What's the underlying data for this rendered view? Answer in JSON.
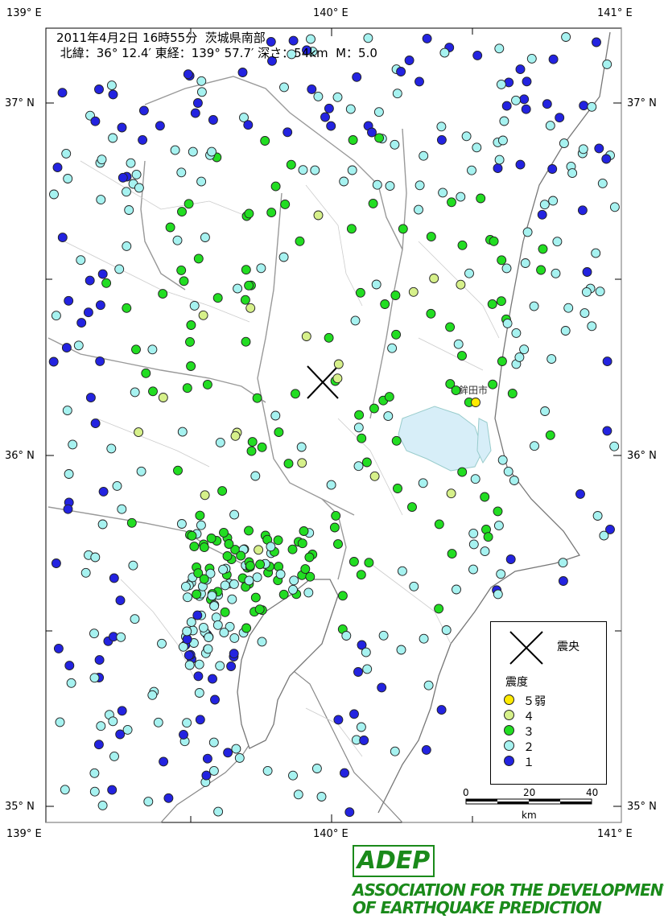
{
  "title": {
    "line1": "2011年4月2日 16時55分  茨城県南部",
    "line2": " 北緯：36° 12.4′ 東経：139° 57.7′ 深さ：54km  M：5.0"
  },
  "axes": {
    "top_left": "139° E",
    "top_mid": "140° E",
    "top_right": "141° E",
    "bottom_left": "139° E",
    "bottom_mid": "140° E",
    "bottom_right": "141° E",
    "left_37": "37° N",
    "left_36": "36° N",
    "left_35": "35° N",
    "right_37": "37° N",
    "right_36": "36° N",
    "right_35": "35° N"
  },
  "city": "鉾田市",
  "legend": {
    "epicenter": "震央",
    "intensity_title": "震度",
    "items": [
      {
        "label": "５弱",
        "color": "#ffea00"
      },
      {
        "label": "４",
        "color": "#d6f08a"
      },
      {
        "label": "３",
        "color": "#22dd22"
      },
      {
        "label": "２",
        "color": "#a6f2f0"
      },
      {
        "label": "１",
        "color": "#2323e0"
      }
    ]
  },
  "scale": {
    "v0": "0",
    "v20": "20",
    "v40": "40",
    "unit": "km"
  },
  "logo": {
    "mark": "ADEP",
    "line1": "ASSOCIATION  FOR THE DEVELOPMENT",
    "line2": "OF EARTHQUAKE PREDICTION"
  },
  "colors": {
    "land": "#ffffff",
    "water": "#d7eef8",
    "border": "#999999",
    "frame": "#000000"
  }
}
